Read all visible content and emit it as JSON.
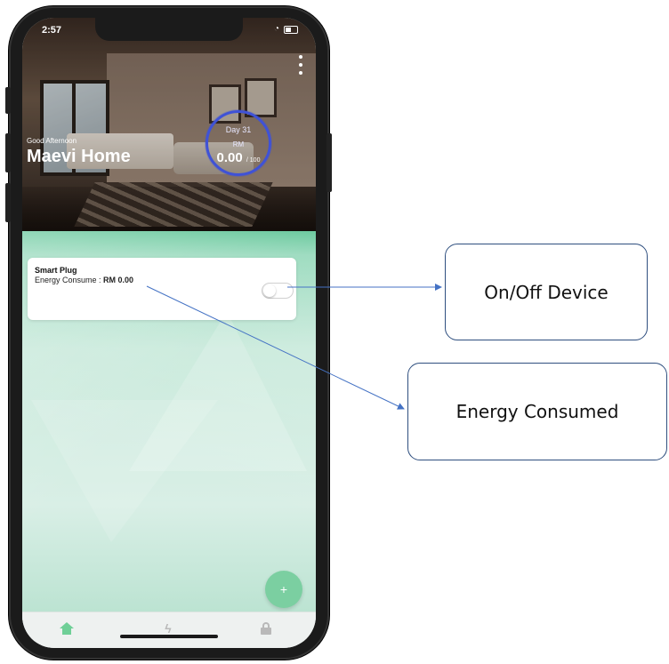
{
  "status_bar": {
    "time": "2:57"
  },
  "header": {
    "greeting": "Good Afternoon",
    "home_name": "Maevi Home",
    "budget": {
      "day": "Day 31",
      "currency": "RM",
      "amount": "0.00",
      "limit": "/ 100"
    }
  },
  "devices": [
    {
      "name": "Smart Plug",
      "energy_label": "Energy Consume : ",
      "energy_value": "RM 0.00",
      "switch_on": false
    }
  ],
  "fab": {
    "label": "+"
  },
  "tabs": [
    {
      "name": "home",
      "icon": "home-icon",
      "active": true
    },
    {
      "name": "energy",
      "icon": "bolt-icon",
      "glyph": "ϟ"
    },
    {
      "name": "lock",
      "icon": "lock-icon"
    }
  ],
  "callouts": {
    "onoff": "On/Off Device",
    "energy": "Energy Consumed"
  },
  "colors": {
    "accent_green": "#52c08e",
    "ring_blue": "#3f52d6",
    "callout_border": "#2f4f7f",
    "arrow": "#4472c4"
  }
}
